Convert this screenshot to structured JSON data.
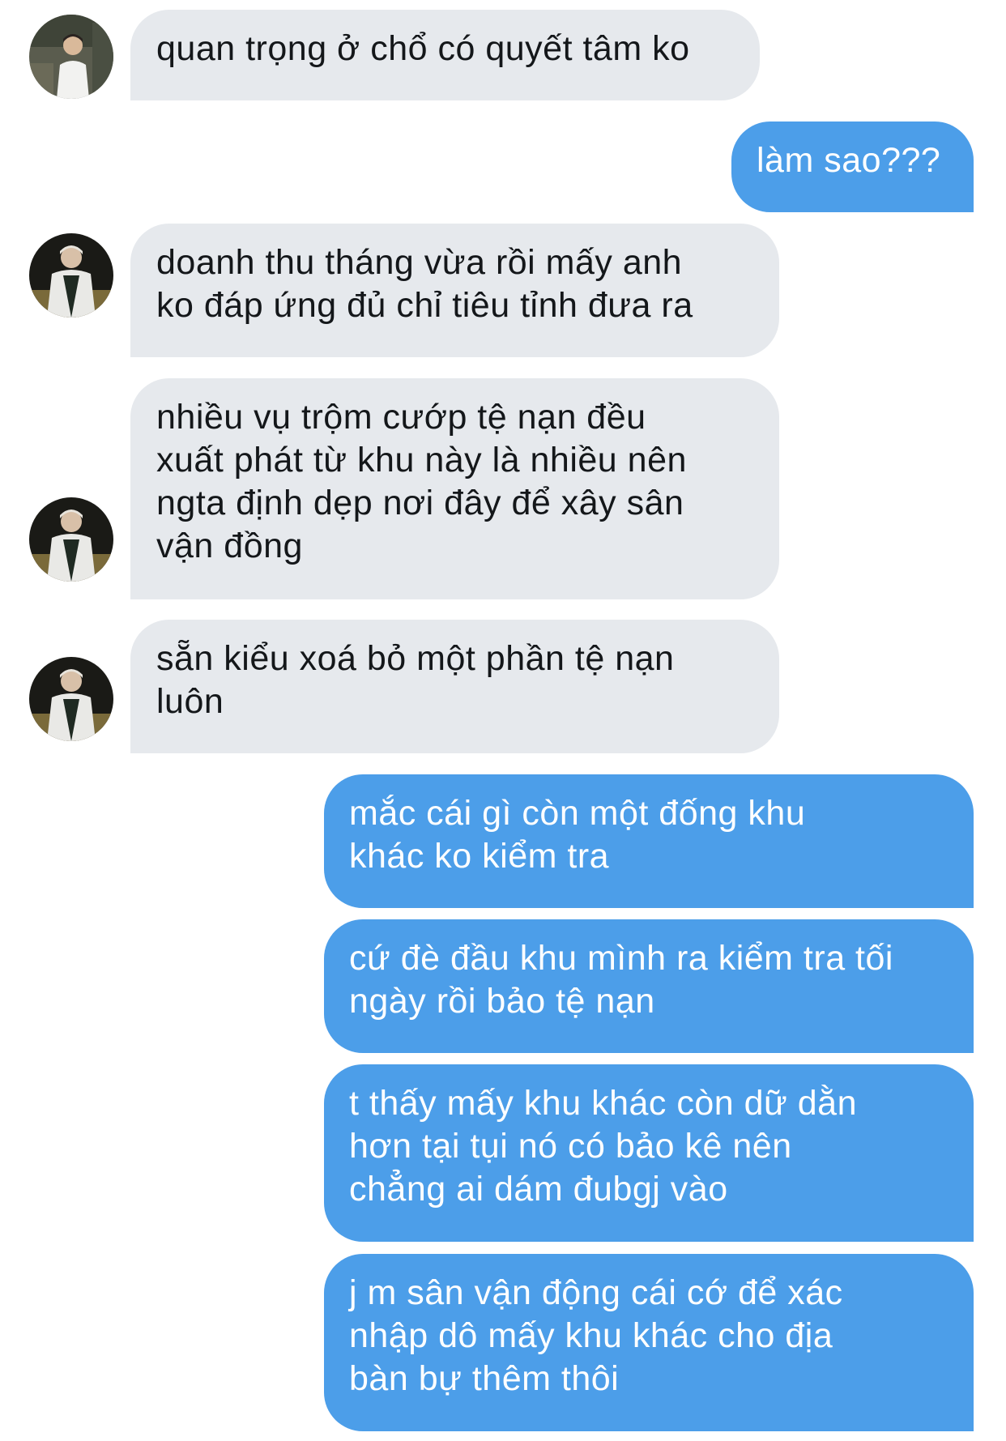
{
  "conversation": {
    "messages": [
      {
        "from": "other",
        "lines": [
          "quan trọng ở chổ có quyết tâm ko"
        ]
      },
      {
        "from": "me",
        "lines": [
          "làm sao???"
        ]
      },
      {
        "from": "other",
        "lines": [
          "doanh thu tháng vừa rồi mấy anh",
          "ko đáp ứng đủ chỉ tiêu tỉnh đưa ra"
        ]
      },
      {
        "from": "other",
        "lines": [
          "nhiều vụ trộm cướp tệ nạn đều",
          "xuất phát từ khu này là nhiều nên",
          "ngta định dẹp nơi đây để xây sân",
          "vận đồng"
        ]
      },
      {
        "from": "other",
        "lines": [
          "sẵn kiểu xoá bỏ một phần tệ nạn",
          "luôn"
        ]
      },
      {
        "from": "me",
        "lines": [
          "mắc cái gì còn một đống khu",
          "khác ko kiểm tra"
        ]
      },
      {
        "from": "me",
        "lines": [
          "cứ đè đầu khu mình ra kiểm tra tối",
          "ngày rồi bảo tệ nạn"
        ]
      },
      {
        "from": "me",
        "lines": [
          "t thấy mấy khu khác còn dữ dằn",
          "hơn tại tụi nó có bảo kê nên",
          "chẳng ai dám đubgj vào"
        ]
      },
      {
        "from": "me",
        "lines": [
          "j m sân vận động cái cớ để xác",
          "nhập dô mấy khu khác cho địa",
          "bàn bự thêm thôi"
        ]
      }
    ]
  },
  "colors": {
    "received_bubble": "#e6e9ed",
    "received_text": "#14171a",
    "sent_bubble": "#4c9ee9",
    "sent_text": "#ffffff"
  },
  "icons": {
    "avatar": "profile-photo"
  }
}
